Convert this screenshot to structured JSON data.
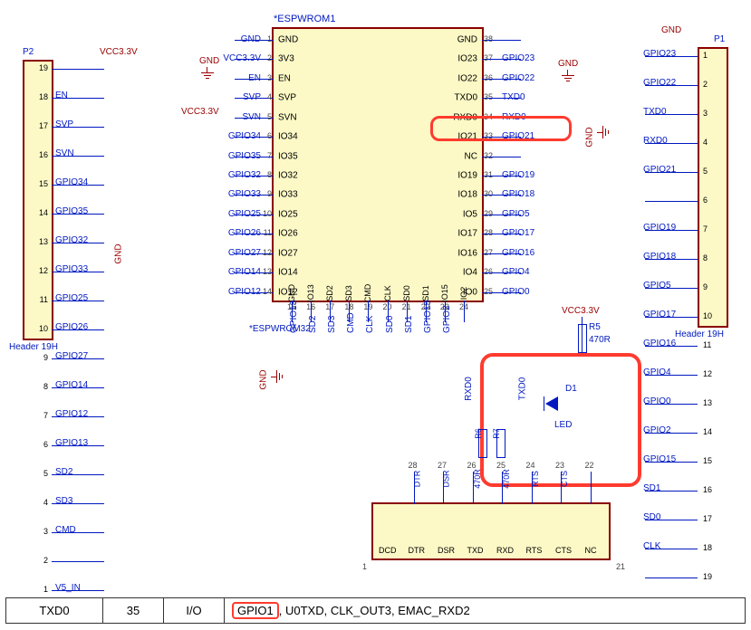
{
  "chip": {
    "ref": "*ESPWROM1",
    "bottom_ref": "*ESPWROM32",
    "left": [
      {
        "n": "1",
        "name": "GND",
        "net": "GND"
      },
      {
        "n": "2",
        "name": "3V3",
        "net": "VCC3.3V"
      },
      {
        "n": "3",
        "name": "EN",
        "net": "EN"
      },
      {
        "n": "4",
        "name": "SVP",
        "net": "SVP"
      },
      {
        "n": "5",
        "name": "SVN",
        "net": "SVN"
      },
      {
        "n": "6",
        "name": "IO34",
        "net": "GPIO34"
      },
      {
        "n": "7",
        "name": "IO35",
        "net": "GPIO35"
      },
      {
        "n": "8",
        "name": "IO32",
        "net": "GPIO32"
      },
      {
        "n": "9",
        "name": "IO33",
        "net": "GPIO33"
      },
      {
        "n": "10",
        "name": "IO25",
        "net": "GPIO25"
      },
      {
        "n": "11",
        "name": "IO26",
        "net": "GPIO26"
      },
      {
        "n": "12",
        "name": "IO27",
        "net": "GPIO27"
      },
      {
        "n": "13",
        "name": "IO14",
        "net": "GPIO14"
      },
      {
        "n": "14",
        "name": "IO12",
        "net": "GPIO12"
      }
    ],
    "right": [
      {
        "n": "38",
        "name": "GND",
        "net": ""
      },
      {
        "n": "37",
        "name": "IO23",
        "net": "GPIO23"
      },
      {
        "n": "36",
        "name": "IO22",
        "net": "GPIO22"
      },
      {
        "n": "35",
        "name": "TXD0",
        "net": "TXD0"
      },
      {
        "n": "34",
        "name": "RXD0",
        "net": "RXD0"
      },
      {
        "n": "33",
        "name": "IO21",
        "net": "GPIO21"
      },
      {
        "n": "32",
        "name": "NC",
        "net": ""
      },
      {
        "n": "31",
        "name": "IO19",
        "net": "GPIO19"
      },
      {
        "n": "30",
        "name": "IO18",
        "net": "GPIO18"
      },
      {
        "n": "29",
        "name": "IO5",
        "net": "GPIO5"
      },
      {
        "n": "28",
        "name": "IO17",
        "net": "GPIO17"
      },
      {
        "n": "27",
        "name": "IO16",
        "net": "GPIO16"
      },
      {
        "n": "26",
        "name": "IO4",
        "net": "GPIO4"
      },
      {
        "n": "25",
        "name": "IO0",
        "net": "GPIO0"
      }
    ],
    "bottom": [
      {
        "n": "15",
        "name": "GND",
        "net": "GPIO13"
      },
      {
        "n": "16",
        "name": "IO13",
        "net": "SD2"
      },
      {
        "n": "17",
        "name": "SD2",
        "net": "SD3"
      },
      {
        "n": "18",
        "name": "SD3",
        "net": "CMD"
      },
      {
        "n": "19",
        "name": "CMD",
        "net": "CLK"
      },
      {
        "n": "20",
        "name": "CLK",
        "net": "SD0"
      },
      {
        "n": "21",
        "name": "SD0",
        "net": "SD1"
      },
      {
        "n": "22",
        "name": "SD1",
        "net": "GPIO15"
      },
      {
        "n": "23",
        "name": "IO15",
        "net": "GPIO2"
      },
      {
        "n": "24",
        "name": "IO2",
        "net": ""
      }
    ]
  },
  "p2": {
    "ref": "P2",
    "label": "Header 19H",
    "pins": [
      {
        "n": "19",
        "net": ""
      },
      {
        "n": "18",
        "net": "EN"
      },
      {
        "n": "17",
        "net": "SVP"
      },
      {
        "n": "16",
        "net": "SVN"
      },
      {
        "n": "15",
        "net": "GPIO34"
      },
      {
        "n": "14",
        "net": "GPIO35"
      },
      {
        "n": "13",
        "net": "GPIO32"
      },
      {
        "n": "12",
        "net": "GPIO33"
      },
      {
        "n": "11",
        "net": "GPIO25"
      },
      {
        "n": "10",
        "net": "GPIO26"
      },
      {
        "n": "9",
        "net": "GPIO27"
      },
      {
        "n": "8",
        "net": "GPIO14"
      },
      {
        "n": "7",
        "net": "GPIO12"
      },
      {
        "n": "6",
        "net": "GPIO13"
      },
      {
        "n": "5",
        "net": "SD2"
      },
      {
        "n": "4",
        "net": "SD3"
      },
      {
        "n": "3",
        "net": "CMD"
      },
      {
        "n": "2",
        "net": ""
      },
      {
        "n": "1",
        "net": "V5_IN"
      }
    ]
  },
  "p1": {
    "ref": "P1",
    "label": "Header 19H",
    "pins": [
      {
        "n": "1",
        "net": "GPIO23"
      },
      {
        "n": "2",
        "net": "GPIO22"
      },
      {
        "n": "3",
        "net": "TXD0"
      },
      {
        "n": "4",
        "net": "RXD0"
      },
      {
        "n": "5",
        "net": "GPIO21"
      },
      {
        "n": "6",
        "net": ""
      },
      {
        "n": "7",
        "net": "GPIO19"
      },
      {
        "n": "8",
        "net": "GPIO18"
      },
      {
        "n": "9",
        "net": "GPIO5"
      },
      {
        "n": "10",
        "net": "GPIO17"
      },
      {
        "n": "11",
        "net": "GPIO16"
      },
      {
        "n": "12",
        "net": "GPIO4"
      },
      {
        "n": "13",
        "net": "GPIO0"
      },
      {
        "n": "14",
        "net": "GPIO2"
      },
      {
        "n": "15",
        "net": "GPIO15"
      },
      {
        "n": "16",
        "net": "SD1"
      },
      {
        "n": "17",
        "net": "SD0"
      },
      {
        "n": "18",
        "net": "CLK"
      },
      {
        "n": "19",
        "net": ""
      }
    ]
  },
  "serial_conn": {
    "top_nets": [
      "DTR",
      "DSR",
      "470R",
      "470R",
      "RTS",
      "CTS",
      ""
    ],
    "top_nums": [
      "28",
      "27",
      "26",
      "25",
      "24",
      "23",
      "22"
    ],
    "bottom_labels": [
      "DCD",
      "DTR",
      "DSR",
      "TXD",
      "RXD",
      "RTS",
      "CTS",
      "NC"
    ],
    "end_left": "1",
    "end_right": "21"
  },
  "led": {
    "vcc": "VCC3.3V",
    "r_ref": "R5",
    "r_val": "470R",
    "d_ref": "D1",
    "d_name": "LED",
    "txd": "TXD0",
    "rxd": "RXD0",
    "r6": "R6",
    "r7": "R7"
  },
  "power": {
    "vcc": "VCC3.3V",
    "gnd": "GND"
  },
  "table": {
    "c1": "TXD0",
    "c2": "35",
    "c3": "I/O",
    "c4_hl": "GPIO1",
    "c4_rest": ", U0TXD, CLK_OUT3, EMAC_RXD2"
  }
}
